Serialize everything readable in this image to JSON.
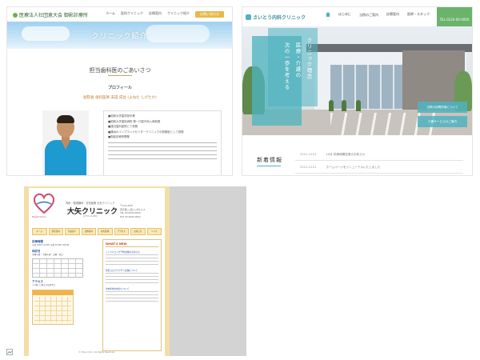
{
  "thumb1": {
    "logo": "医療法人社団恵大会 御影診療所",
    "nav": [
      "ホーム",
      "医科クリニック",
      "診療案内",
      "クリニック紹介",
      "お問い合わせ"
    ],
    "banner_title": "クリニック紹介",
    "heading": "担当歯科医のごあいさつ",
    "subheading": "プロフィール",
    "doctor_name": "副院長 歯科医師 末田 成位 (よねた しげたか)",
    "career": [
      "■昭和大学歯学部卒業",
      "■昭和大学歯科病院 第一口腔外科入局勤務",
      "■渡辺歯科医院にて勤務",
      "■横浜のインプラントセンタークリニックの勤務医として勤務",
      "■御影診療所開業"
    ]
  },
  "thumb2": {
    "logo": "さいとう内科クリニック",
    "nav": [
      "はじめに",
      "当院のご案内",
      "診療案内",
      "医師・スタッフ",
      "アクセス"
    ],
    "tel": "TEL 0120-00-0000",
    "hero_text": [
      "クリニック理念",
      "医療・介護の",
      "次の一歩を考える"
    ],
    "badges": [
      "当院の訪問診療について",
      "介護サービスのご案内"
    ],
    "news_title": "新着情報",
    "news": [
      {
        "date": "2021.10.01",
        "text": "10月 診療時間変更のお知らせ"
      },
      {
        "date": "2021.10.01",
        "text": "ホームページをリニューアルいたしました"
      }
    ]
  },
  "thumb3": {
    "brand": "Heart Clinic",
    "subtitle": "内科・循環器科・在宅医療 大矢クリニック",
    "name": "大矢クリニック",
    "romaji": "OHYA CLINIC",
    "address": [
      "〒123-4567",
      "東京都○○区○○町1-2-3",
      "TEL 03-0000-0000",
      "FAX 03-0000-0001"
    ],
    "menu": [
      "ホーム",
      "医院案内",
      "院長紹介",
      "診療案内",
      "在宅医療",
      "アクセス",
      "お知らせ",
      "リンク"
    ],
    "sections": {
      "hours_title": "診療時間",
      "hours_text": "午前 9:00〜12:00 午後 15:00〜18:00",
      "closed_title": "休診日",
      "closed_text": "木曜午後・土曜午後・日曜・祝日",
      "access_title": "アクセス",
      "access_text": "○○線○○駅より徒歩5分"
    },
    "whats_new": "WHAT'S NEW",
    "notices": [
      "インフルエンザ予防接種のお知らせ",
      "新型コロナワクチン接種について",
      "年末年始の休診について"
    ],
    "footer": "© Ohya Clinic. All Rights Reserved."
  }
}
